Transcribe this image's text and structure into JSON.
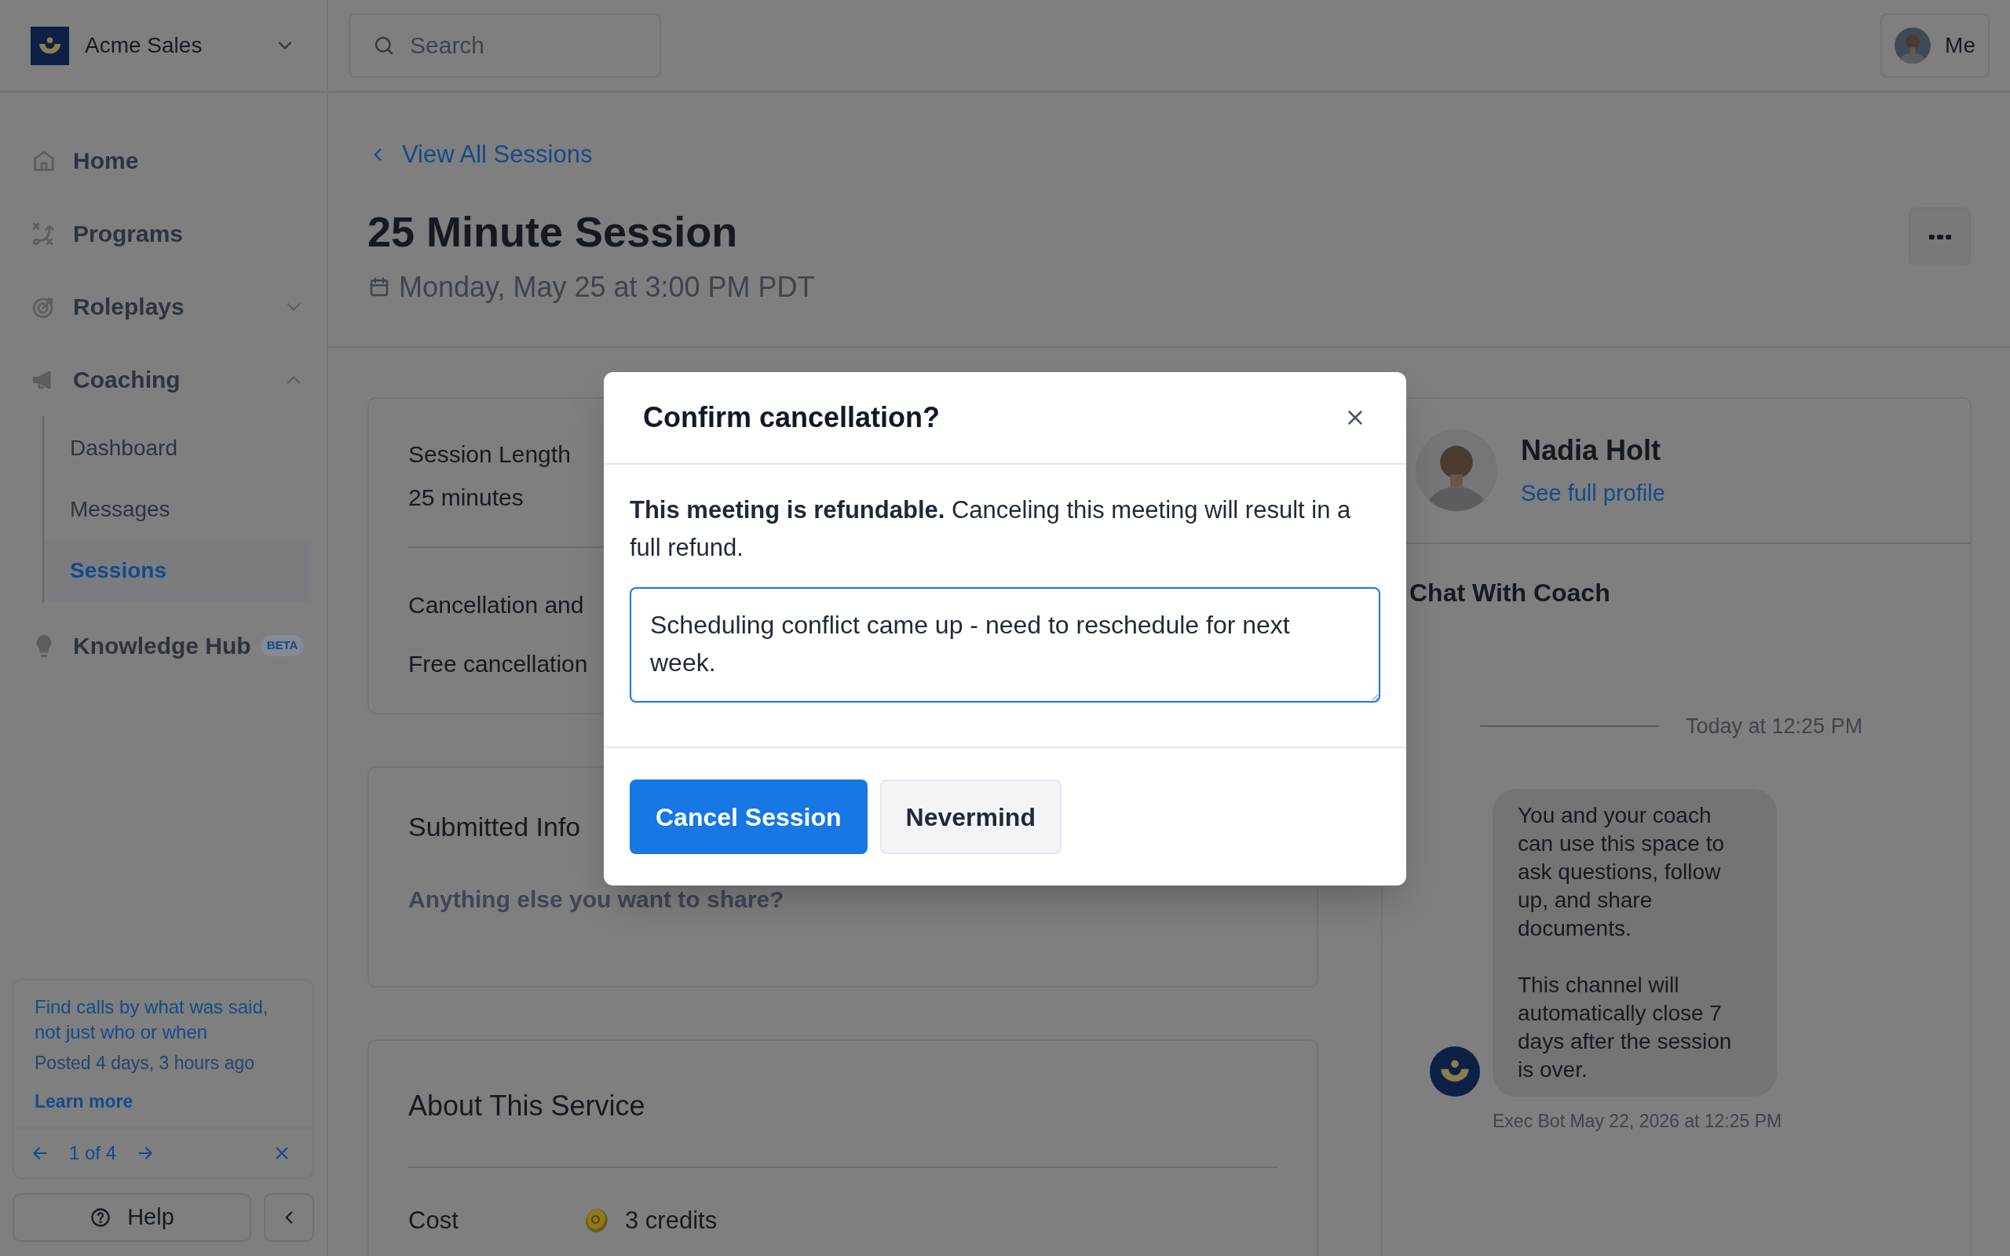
{
  "workspace": {
    "name": "Acme Sales"
  },
  "search": {
    "placeholder": "Search"
  },
  "account": {
    "label": "Me"
  },
  "sidebar": {
    "items": [
      {
        "label": "Home",
        "selected": false
      },
      {
        "label": "Programs",
        "selected": false
      },
      {
        "label": "Roleplays",
        "selected": false,
        "expanded": false
      },
      {
        "label": "Coaching",
        "selected": false,
        "expanded": true,
        "children": [
          {
            "label": "Dashboard",
            "selected": false
          },
          {
            "label": "Messages",
            "selected": false
          },
          {
            "label": "Sessions",
            "selected": true
          }
        ]
      },
      {
        "label": "Knowledge Hub",
        "selected": false,
        "badge": "BETA"
      }
    ]
  },
  "announcement": {
    "title": "Find calls by what was said, not just who or when",
    "posted": "Posted 4 days, 3 hours ago",
    "link": "Learn more",
    "pager": "1 of 4"
  },
  "help": {
    "label": "Help"
  },
  "page": {
    "back_link": "View All Sessions",
    "title": "25 Minute Session",
    "date": "Monday, May 25 at 3:00 PM PDT"
  },
  "details": [
    {
      "label": "Session Length",
      "value": "25 minutes"
    },
    {
      "label": "Cancellation and",
      "value": "Free cancellation"
    }
  ],
  "submitted": {
    "title": "Submitted Info",
    "prompt": "Anything else you want to share?"
  },
  "about": {
    "title": "About This Service",
    "rows": [
      {
        "label": "Cost",
        "value": "3 credits"
      }
    ]
  },
  "coach": {
    "name": "Nadia Holt",
    "link": "See full profile",
    "chat_title": "Chat With Coach",
    "divider_time": "Today at 12:25 PM",
    "messages": [
      {
        "paragraphs": [
          "You and your coach can use this space to ask questions, follow up, and share documents.",
          "This channel will automatically close 7 days after the session is over."
        ],
        "meta": "Exec Bot May 22, 2026 at 12:25 PM"
      }
    ]
  },
  "modal": {
    "title": "Confirm cancellation?",
    "message": "**This meeting is refundable.** Canceling this meeting will result in a full refund.",
    "reason": "Scheduling conflict came up - need to reschedule for next week.",
    "buttons": [
      {
        "label": "Cancel Session",
        "kind": "primary"
      },
      {
        "label": "Nevermind",
        "kind": "secondary"
      }
    ]
  }
}
